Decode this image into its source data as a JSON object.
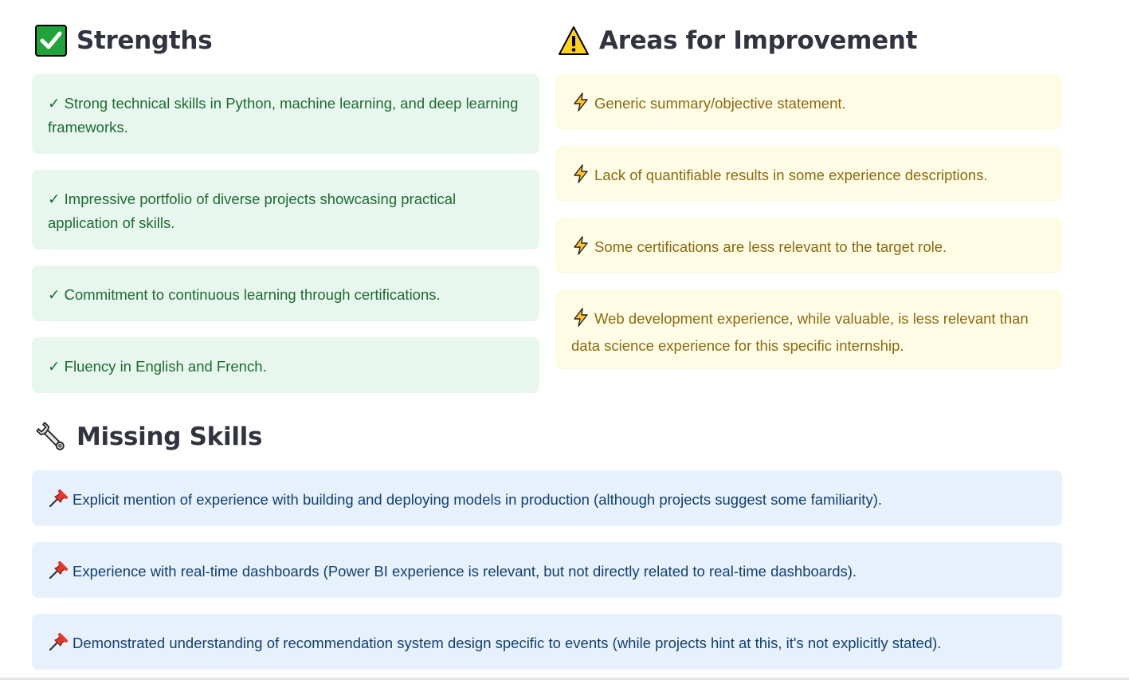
{
  "strengths": {
    "icon": "check-mark-button-icon",
    "title": "Strengths",
    "marker": "✓",
    "items": [
      "Strong technical skills in Python, machine learning, and deep learning frameworks.",
      "Impressive portfolio of diverse projects showcasing practical application of skills.",
      "Commitment to continuous learning through certifications.",
      "Fluency in English and French."
    ]
  },
  "improvements": {
    "icon": "warning-icon",
    "title": "Areas for Improvement",
    "item_icon": "lightning-bolt-icon",
    "items": [
      "Generic summary/objective statement.",
      "Lack of quantifiable results in some experience descriptions.",
      "Some certifications are less relevant to the target role.",
      "Web development experience, while valuable, is less relevant than data science experience for this specific internship."
    ]
  },
  "missing": {
    "icon": "wrench-icon",
    "title": "Missing Skills",
    "item_icon": "pushpin-icon",
    "items": [
      "Explicit mention of experience with building and deploying models in production (although projects suggest some familiarity).",
      "Experience with real-time dashboards (Power BI experience is relevant, but not directly related to real-time dashboards).",
      "Demonstrated understanding of recommendation system design specific to events (while projects hint at this, it's not explicitly stated)."
    ]
  },
  "colors": {
    "strength_bg": "#e8f7ed",
    "strength_text": "#1c6b32",
    "improvement_bg": "#fffce6",
    "improvement_text": "#8a6a10",
    "missing_bg": "#e6f1fb",
    "missing_text": "#12406f"
  }
}
